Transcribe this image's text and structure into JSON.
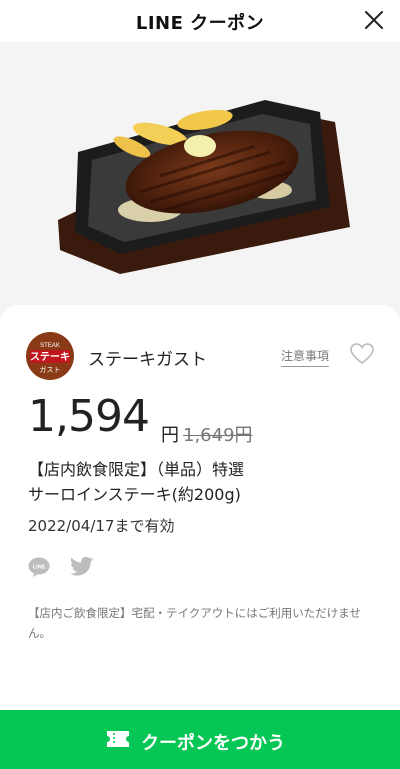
{
  "header": {
    "title": "LINE クーポン"
  },
  "brand": {
    "name": "ステーキガスト",
    "logo_text_small": "STEAK",
    "logo_text_main": "ステーキ",
    "logo_text_sub": "ガスト"
  },
  "actions": {
    "notes_label": "注意事項"
  },
  "offer": {
    "price": "1,594",
    "price_unit": "円",
    "original_price": "1,649円",
    "title_line1": "【店内飲食限定】（単品）特選",
    "title_line2": "サーロインステーキ(約200g)",
    "expiry": "2022/04/17まで有効"
  },
  "share": {
    "line_icon_text": "LINE"
  },
  "note": "【店内ご飲食限定】宅配・テイクアウトにはご利用いただけません。",
  "cta": {
    "label": "クーポンをつかう"
  },
  "colors": {
    "cta": "#06c755",
    "logo": "#8a3a16"
  }
}
